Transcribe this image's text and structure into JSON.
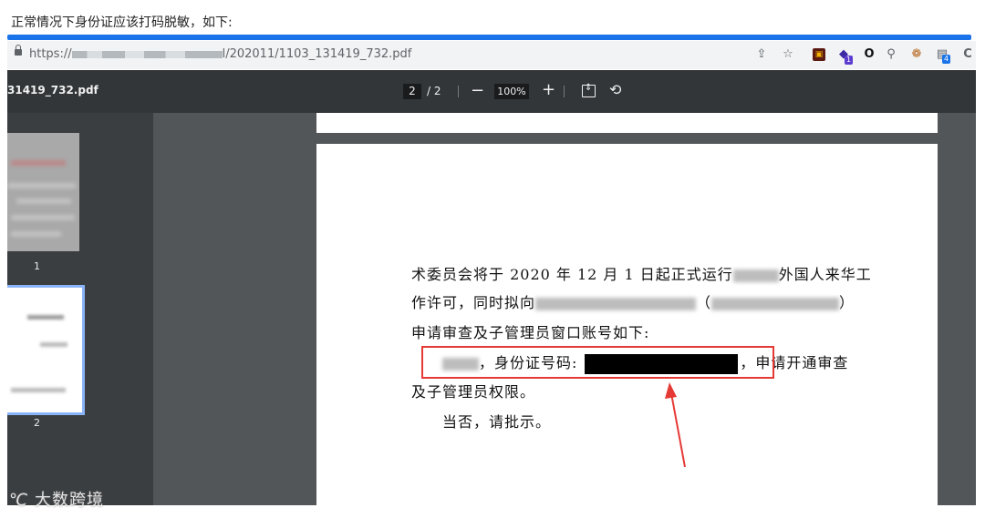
{
  "caption": "正常情况下身份证应该打码脱敏，如下:",
  "address_bar": {
    "url_prefix": "https://",
    "url_suffix": "l/202011/1103_131419_732.pdf"
  },
  "extensions": [
    "share-icon",
    "star-icon",
    "ext-box-icon",
    "ext-stack-icon",
    "ext-ring-icon",
    "ext-link-icon",
    "ext-cookie-icon",
    "ext-badge-icon"
  ],
  "ext_badges": {
    "stack": "1",
    "last": "4"
  },
  "pdf_toolbar": {
    "title": "31419_732.pdf",
    "page_current": "2",
    "page_total": "/ 2",
    "zoom": "100%",
    "minus": "−",
    "plus": "+"
  },
  "thumbnails": {
    "page1_label": "1",
    "page2_label": "2"
  },
  "document": {
    "line1_start": "术委员会将于 2020 年 12 月 1 日起正式运行",
    "line1_end": "外国人来华工",
    "line2_start": "作许可，同时拟向",
    "line2_paren_open": "（",
    "line2_paren_close": "）",
    "line3": "申请审查及子管理员窗口账号如下:",
    "line4_id_label": "，身份证号码:",
    "line4_end": "，申请开通审查",
    "line5": "及子管理员权限。",
    "line6": "当否，请批示。"
  },
  "watermark": "大数跨境",
  "colors": {
    "accent_blue": "#1a73e8",
    "highlight_red": "#e53935",
    "viewer_bg": "#525659",
    "toolbar_bg": "#323639"
  }
}
